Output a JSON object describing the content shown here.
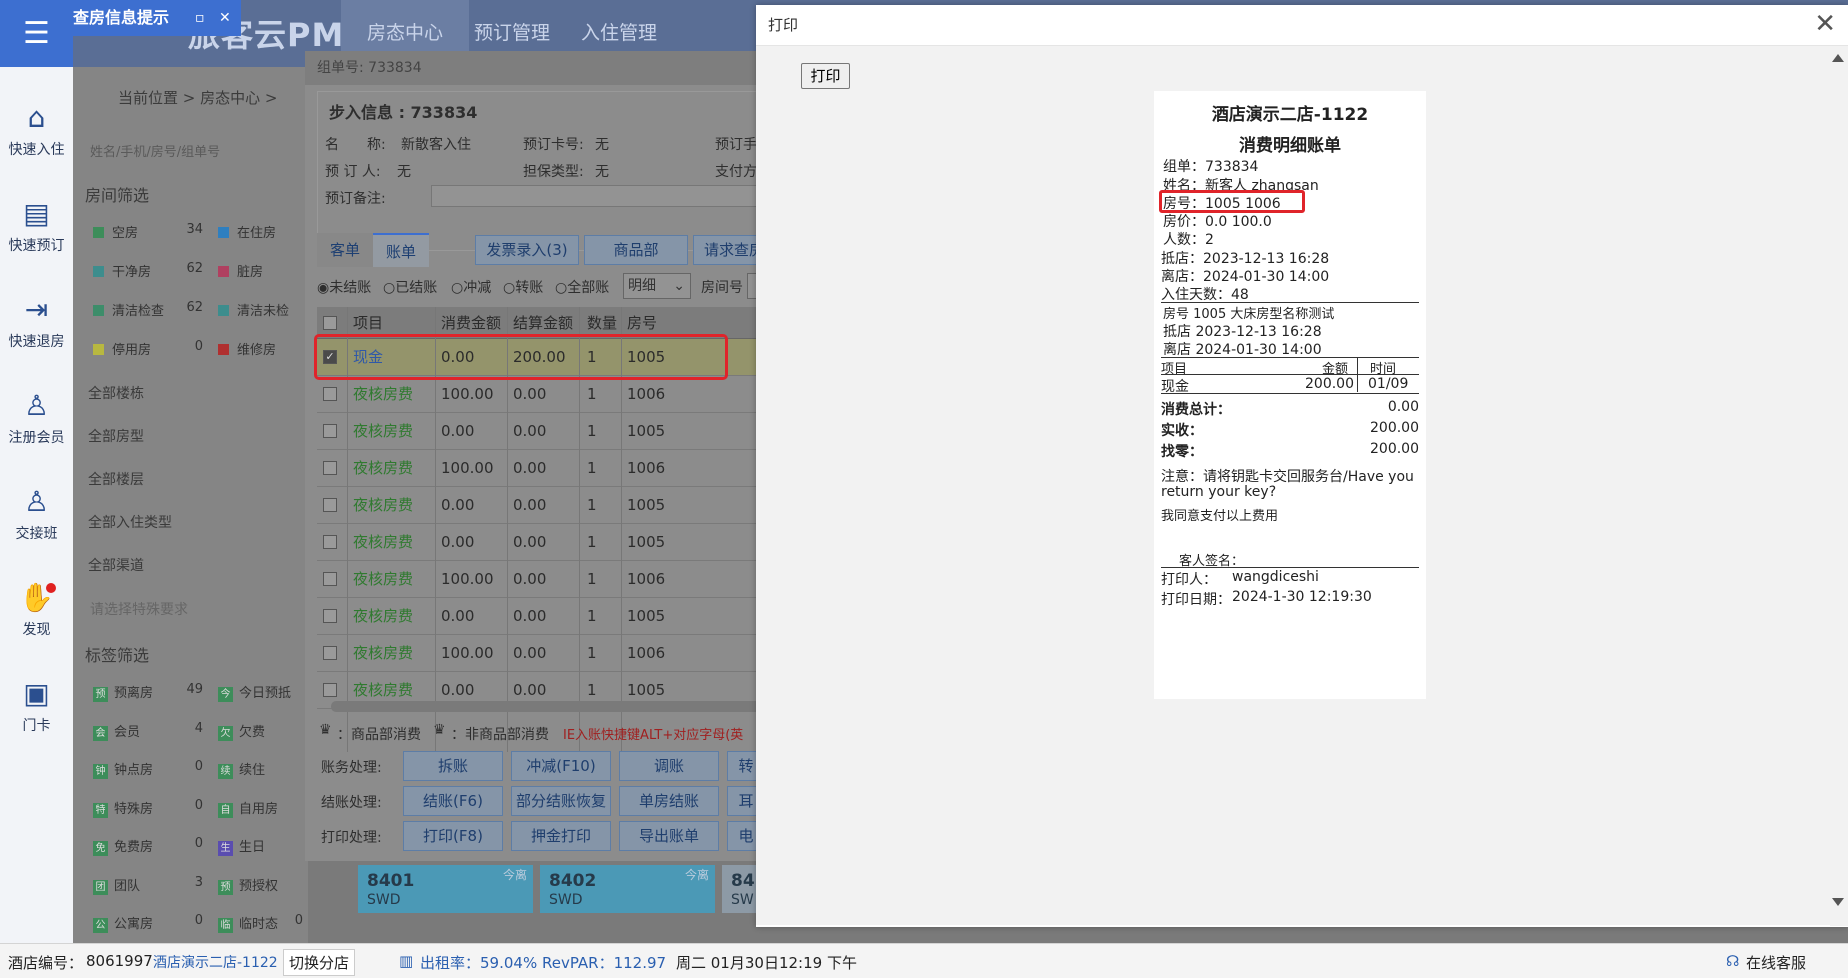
{
  "app": {
    "title": "旅客云PMS",
    "tip_tab": "查房信息提示",
    "tip_min": "▫",
    "tip_close": "✕",
    "top_tabs": [
      "房态中心",
      "预订管理",
      "入住管理"
    ]
  },
  "left_nav": [
    {
      "label": "快速入住",
      "icon": "⌂"
    },
    {
      "label": "快速预订",
      "icon": "▤"
    },
    {
      "label": "快速退房",
      "icon": "⇥"
    },
    {
      "label": "注册会员",
      "icon": "♙"
    },
    {
      "label": "交接班",
      "icon": "♙"
    },
    {
      "label": "发现",
      "icon": "✋"
    },
    {
      "label": "门卡",
      "icon": "▣"
    }
  ],
  "breadcrumb": "当前位置 > 房态中心 >",
  "search_placeholder": "姓名/手机/房号/组单号",
  "room_filter": {
    "title": "房间筛选",
    "statuses": [
      {
        "label": "空房",
        "count": "34",
        "color": "#3d8d5a"
      },
      {
        "label": "在住房",
        "count": "",
        "color": "#2f7fbf"
      },
      {
        "label": "干净房",
        "count": "62",
        "color": "#3d8d8d"
      },
      {
        "label": "脏房",
        "count": "",
        "color": "#b04060"
      },
      {
        "label": "清洁检查",
        "count": "62",
        "color": "#3d8d6a"
      },
      {
        "label": "清洁未检",
        "count": "",
        "color": "#3d8d8d"
      },
      {
        "label": "停用房",
        "count": "0",
        "color": "#b8b840"
      },
      {
        "label": "维修房",
        "count": "",
        "color": "#b03030"
      }
    ],
    "dropdowns": [
      "全部楼栋",
      "全部房型",
      "全部楼层",
      "全部入住类型",
      "全部渠道"
    ],
    "special_placeholder": "请选择特殊要求"
  },
  "tag_filter": {
    "title": "标签筛选",
    "tags": [
      {
        "badge": "预",
        "label": "预离房",
        "count": "49",
        "color": "#3d8d5a"
      },
      {
        "badge": "今",
        "label": "今日预抵",
        "count": "",
        "color": "#3d8d5a"
      },
      {
        "badge": "会",
        "label": "会员",
        "count": "4",
        "color": "#3d8d5a"
      },
      {
        "badge": "欠",
        "label": "欠费",
        "count": "",
        "color": "#3d8d5a"
      },
      {
        "badge": "钟",
        "label": "钟点房",
        "count": "0",
        "color": "#3d8d5a"
      },
      {
        "badge": "续",
        "label": "续住",
        "count": "",
        "color": "#3d8d5a"
      },
      {
        "badge": "特",
        "label": "特殊房",
        "count": "0",
        "color": "#3d8d5a"
      },
      {
        "badge": "自",
        "label": "自用房",
        "count": "",
        "color": "#3d8d5a"
      },
      {
        "badge": "免",
        "label": "免费房",
        "count": "0",
        "color": "#3d8d5a"
      },
      {
        "badge": "生",
        "label": "生日",
        "count": "",
        "color": "#5a4db0"
      },
      {
        "badge": "团",
        "label": "团队",
        "count": "3",
        "color": "#3d8d5a"
      },
      {
        "badge": "预",
        "label": "预授权",
        "count": "",
        "color": "#3d8d5a"
      },
      {
        "badge": "公",
        "label": "公寓房",
        "count": "0",
        "color": "#3d8d5a"
      },
      {
        "badge": "临",
        "label": "临时态",
        "count": "0",
        "color": "#3d8d5a"
      }
    ]
  },
  "rooms": [
    {
      "num": "8401",
      "type": "SWD",
      "tag": "今离"
    },
    {
      "num": "8402",
      "type": "SWD",
      "tag": "今离"
    },
    {
      "num": "84",
      "type": "SW",
      "tag": ""
    }
  ],
  "bill_dialog": {
    "header": "组单号: 733834",
    "step_info": "步入信息 : 733834",
    "name_label": "名　　称:",
    "name_value": "新散客入住",
    "booking_card_label": "预订卡号:",
    "booking_card_value": "无",
    "booking_hand_label": "预订手",
    "booker_label": "预 订 人:",
    "booker_value": "无",
    "guarantee_label": "担保类型:",
    "guarantee_value": "无",
    "pay_label": "支付方",
    "remark_label": "预订备注:",
    "tabs": [
      "客单",
      "账单"
    ],
    "action_tabs": [
      "发票录入(3)",
      "商品部",
      "请求查房"
    ],
    "filters": [
      "◉未结账",
      "○已结账",
      "○冲减",
      "○转账",
      "○全部账"
    ],
    "detail_select": "明细",
    "room_no_label": "房间号",
    "columns": [
      "项目",
      "消费金额",
      "结算金额",
      "数量",
      "房号"
    ],
    "rows": [
      {
        "item": "现金",
        "consume": "0.00",
        "settle": "200.00",
        "qty": "1",
        "room": "1005",
        "checked": true
      },
      {
        "item": "夜核房费",
        "consume": "100.00",
        "settle": "0.00",
        "qty": "1",
        "room": "1006",
        "checked": false
      },
      {
        "item": "夜核房费",
        "consume": "0.00",
        "settle": "0.00",
        "qty": "1",
        "room": "1005",
        "checked": false
      },
      {
        "item": "夜核房费",
        "consume": "100.00",
        "settle": "0.00",
        "qty": "1",
        "room": "1006",
        "checked": false
      },
      {
        "item": "夜核房费",
        "consume": "0.00",
        "settle": "0.00",
        "qty": "1",
        "room": "1005",
        "checked": false
      },
      {
        "item": "夜核房费",
        "consume": "0.00",
        "settle": "0.00",
        "qty": "1",
        "room": "1005",
        "checked": false
      },
      {
        "item": "夜核房费",
        "consume": "100.00",
        "settle": "0.00",
        "qty": "1",
        "room": "1006",
        "checked": false
      },
      {
        "item": "夜核房费",
        "consume": "0.00",
        "settle": "0.00",
        "qty": "1",
        "room": "1005",
        "checked": false
      },
      {
        "item": "夜核房费",
        "consume": "100.00",
        "settle": "0.00",
        "qty": "1",
        "room": "1006",
        "checked": false
      },
      {
        "item": "夜核房费",
        "consume": "0.00",
        "settle": "0.00",
        "qty": "1",
        "room": "1005",
        "checked": false
      }
    ],
    "legend_goods": "：商品部消费",
    "legend_nongoods": "：非商品部消费",
    "hotkey_hint": "IE入账快捷键ALT+对应字母(英",
    "finance_label": "账务处理:",
    "finance_buttons": [
      "拆账",
      "冲减(F10)",
      "调账",
      "转"
    ],
    "checkout_label": "结账处理:",
    "checkout_buttons": [
      "结账(F6)",
      "部分结账恢复",
      "单房结账",
      "耳"
    ],
    "print_label": "打印处理:",
    "print_buttons": [
      "打印(F8)",
      "押金打印",
      "导出账单",
      "电"
    ]
  },
  "print_modal": {
    "title": "打印",
    "close": "✕",
    "print_button": "打印",
    "receipt": {
      "hotel": "酒店演示二店-1122",
      "doc_title": "消费明细账单",
      "group_label": "组单：",
      "group": "733834",
      "name_label": "姓名：",
      "name": "新客人 zhangsan",
      "room_label": "房号：",
      "room": "1005 1006",
      "price_label": "房价：",
      "price": "0.0 100.0",
      "guests_label": "人数：",
      "guests": "2",
      "arrive_label": "抵店：",
      "arrive": "2023-12-13 16:28",
      "leave_label": "离店：",
      "leave": "2024-01-30 14:00",
      "days_label": "入住天数：",
      "days": "48",
      "room_detail": "房号 1005 大床房型名称测试",
      "room_arrive": "抵店 2023-12-13 16:28",
      "room_leave": "离店 2024-01-30 14:00",
      "col_item": "项目",
      "col_amount": "金额",
      "col_time": "时间",
      "line_item": "现金",
      "line_amount": "200.00",
      "line_time": "01/09",
      "total_label": "消费总计：",
      "total": "0.00",
      "paid_label": "实收：",
      "paid": "200.00",
      "change_label": "找零：",
      "change": "200.00",
      "notice": "注意：请将钥匙卡交回服务台/Have you",
      "notice2": "return your key?",
      "agree": "我同意支付以上费用",
      "sign_label": "客人签名：",
      "printer_label": "打印人：",
      "printer": "wangdiceshi",
      "print_date_label": "打印日期：",
      "print_date": "2024-1-30 12:19:30"
    }
  },
  "status_bar": {
    "hotel_no_label": "酒店编号：",
    "hotel_no": "8061997",
    "hotel_name": "酒店演示二店-1122",
    "switch_branch": "切换分店",
    "occupancy": "出租率：59.04% RevPAR：112.97",
    "datetime": "周二 01月30日12:19 下午",
    "online_service": "在线客服"
  },
  "colors": {
    "accent": "#3d6fd0",
    "highlight": "#e0242a",
    "link": "#2a5fb0",
    "green": "#3a9b3a"
  }
}
